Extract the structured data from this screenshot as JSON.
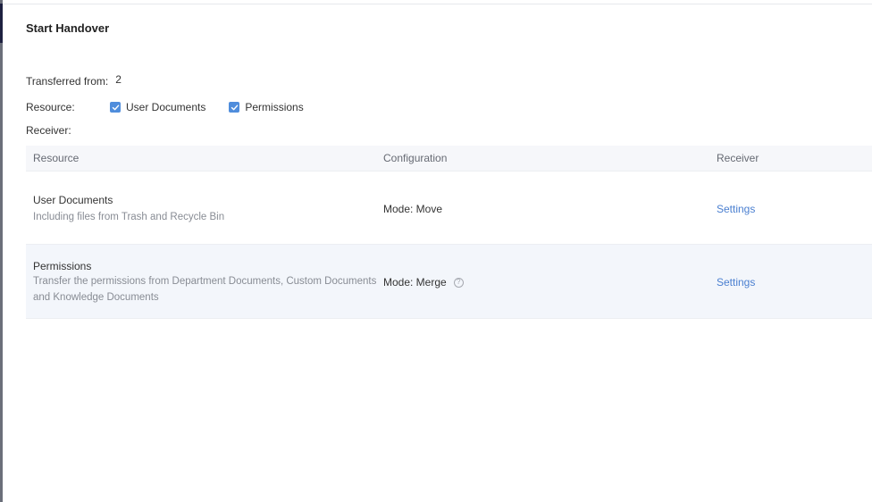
{
  "dialog": {
    "title": "Start Handover"
  },
  "form": {
    "transferred_from_label": "Transferred from:",
    "transferred_from_value": "2",
    "resource_label": "Resource:",
    "resource_options": [
      {
        "label": "User Documents",
        "checked": true
      },
      {
        "label": "Permissions",
        "checked": true
      }
    ],
    "receiver_label": "Receiver:"
  },
  "table": {
    "headers": [
      "Resource",
      "Configuration",
      "Receiver"
    ],
    "rows": [
      {
        "title": "User Documents",
        "description": "Including files from Trash and Recycle Bin",
        "mode": "Mode: Move",
        "receiver_action": "Settings"
      },
      {
        "title": "Permissions",
        "description_line1": "Transfer the permissions from Department Documents, Custom Documents",
        "description_line2": "and Knowledge Documents",
        "mode": "Mode: Merge",
        "help_glyph": "?",
        "receiver_action": "Settings"
      }
    ]
  },
  "colors": {
    "accent": "#4f8ddc",
    "link": "#4a7fd0",
    "header_bg": "#f6f7fa",
    "highlight_row_bg": "#f3f6fb"
  },
  "icons": {
    "checkbox": "checkmark-icon",
    "help": "question-circle-icon"
  }
}
